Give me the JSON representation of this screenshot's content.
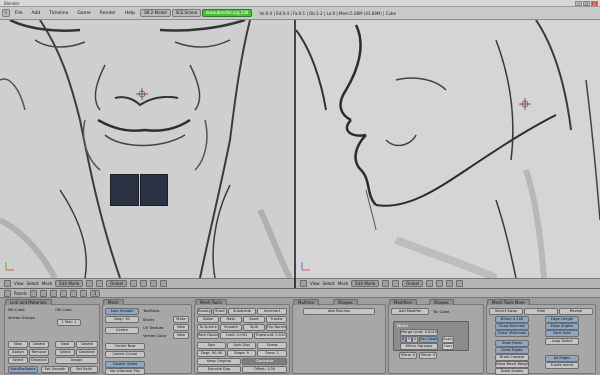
{
  "window": {
    "title": "Blender"
  },
  "menu": {
    "items": [
      "File",
      "Add",
      "Timeline",
      "Game",
      "Render",
      "Help"
    ],
    "screen": "SR:2-Model",
    "scene": "SCE:Scene",
    "url": "www.blender.org 248",
    "stats": "Ve:0-4 | Ed:0-4 | Fa:0-1 | Ob:1-2 | La:0 | Mem:5.08M (43.69M) | Cube"
  },
  "viewport_header": {
    "view": "View",
    "select": "Select",
    "mesh": "Mesh",
    "mode": "Edit Mode",
    "pivot": "Global"
  },
  "buttons_header": {
    "panels": "Panels",
    "frame": "1"
  },
  "panels": {
    "link": {
      "tab": "Link and Materials",
      "me": "ME:Cube",
      "ob": "OB:Cube",
      "vgroups": "Vertex Groups",
      "mat": "1 Mat: 1",
      "new": "New",
      "delete": "Delete",
      "copy_group": "Copy Group",
      "assign": "Assign",
      "remove": "Remove",
      "select": "Select",
      "deselect": "Deselect",
      "autotex": "AutoTexSpace",
      "set_smooth": "Set Smooth",
      "set_solid": "Set Solid"
    },
    "mesh": {
      "tab": "Mesh",
      "auto_smooth": "Auto Smooth",
      "degr": "Degr: 30",
      "sticky": "Sticky",
      "uv_texture": "UV Texture",
      "vertex_color": "Vertex Color",
      "make": "Make",
      "new": "New",
      "new2": "New",
      "texmesh": "TexMesh:",
      "centre": "Centre",
      "centre_new": "Centre New",
      "centre_cursor": "Centre Cursor",
      "double_sided": "Double Sided",
      "no_vnormal_flip": "No V.Normal Flip"
    },
    "mesh_tools": {
      "tab": "Mesh Tools",
      "beauty": "Beauty",
      "short": "Short",
      "subdivide": "Subdivide",
      "innervert": "Innervert",
      "noise": "Noise",
      "hash": "Hash",
      "xsort": "Xsort",
      "fractal": "Fractal",
      "to_sphere": "To Sphere",
      "smooth": "Smooth",
      "split": "Split",
      "flip_normals": "Flip Normals",
      "rem_doubles": "Rem Doubles",
      "limit": "Limit: 0.001",
      "threshold": "Threshold: 0.010",
      "spin": "Spin",
      "spin_dup": "Spin Dup",
      "screw": "Screw",
      "degr": "Degr: 90.00",
      "steps": "Steps: 9",
      "turns": "Turns: 1",
      "keep_original": "Keep Original",
      "clockwise": "Clockwise",
      "extrude_dup": "Extrude Dup",
      "offset": "Offset: 1.00"
    },
    "multires": {
      "tab": "Multires",
      "tab2": "Shapes",
      "add": "Add Multires"
    },
    "modifiers": {
      "tab": "Modifiers",
      "tab2": "Shapes",
      "add": "Add Modifier",
      "to": "To: Cube",
      "mirror": "Mirror",
      "merge": "Merge Limit: 0.0010",
      "x": "X",
      "y": "Y",
      "z": "Z",
      "do_clipping": "Do Clipping",
      "mirror_vgroups": "Mirror Vgroups",
      "mirror_u": "Mirror U",
      "mirror_v": "Mirror V",
      "apply": "Apply",
      "copy": "Copy"
    },
    "mesh_tools_more": {
      "tab": "Mesh Tools More",
      "select_swap": "Select Swap",
      "hide": "Hide",
      "reveal": "Reveal",
      "nsize": "NSize: 0.100",
      "draw_normals": "Draw Normals",
      "draw_vnormals": "Draw VNormals",
      "edge_length": "Edge Length",
      "edge_angles": "Edge Angles",
      "face_area": "Face Area",
      "loop_select": "Loop Select",
      "draw_faces": "Draw Faces",
      "draw_edges": "Draw Edges",
      "draw_creases": "Draw Creases",
      "draw_bevel": "Draw Bevel Weights",
      "draw_seams": "Draw Seams",
      "draw_sharp": "Draw Sharp",
      "all_edges": "All Edges",
      "x_axis_mirror": "X-axis mirror"
    }
  }
}
